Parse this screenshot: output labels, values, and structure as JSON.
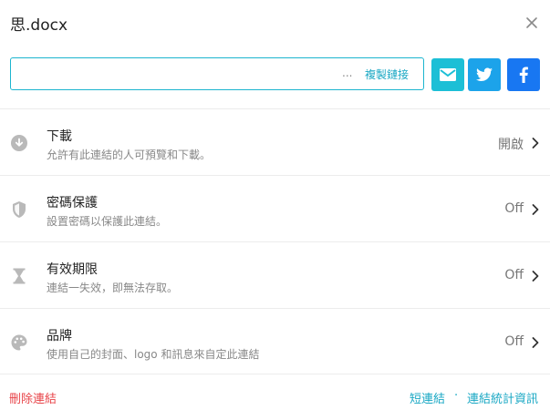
{
  "dialog": {
    "title": "思.docx",
    "close_icon": "close-icon"
  },
  "link": {
    "value": "",
    "ellipsis": "...",
    "copy_label": "複製鏈接"
  },
  "share": {
    "email_icon": "mail-icon",
    "twitter_icon": "twitter-icon",
    "facebook_icon": "facebook-icon",
    "colors": {
      "email": "#1cbfd6",
      "twitter": "#1ca3ea",
      "facebook": "#1877f2"
    }
  },
  "options": [
    {
      "icon": "download-icon",
      "title": "下載",
      "description": "允許有此連結的人可預覽和下載。",
      "status": "開啟"
    },
    {
      "icon": "shield-icon",
      "title": "密碼保護",
      "description": "設置密碼以保護此連結。",
      "status": "Off"
    },
    {
      "icon": "hourglass-icon",
      "title": "有效期限",
      "description": "連結一失效，即無法存取。",
      "status": "Off"
    },
    {
      "icon": "palette-icon",
      "title": "品牌",
      "description": "使用自己的封面、logo 和訊息來自定此連結",
      "status": "Off"
    }
  ],
  "footer": {
    "delete_label": "刪除連結",
    "short_link_label": "短連結",
    "separator": "·",
    "stats_label": "連結統計資訊"
  },
  "colors": {
    "accent": "#1aa8c4",
    "danger": "#e8454a"
  }
}
